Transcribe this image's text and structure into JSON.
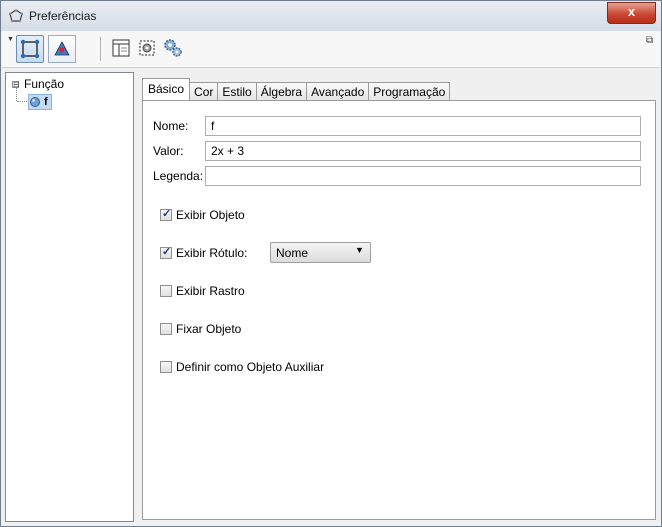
{
  "window": {
    "title": "Preferências",
    "close_label": "x"
  },
  "toolbar": {
    "buttons": [
      {
        "icon": "selection-rectangle-icon",
        "selected": true
      },
      {
        "icon": "graphics-view-icon",
        "selected": false
      },
      {
        "icon": "layout-icon",
        "selected": false
      },
      {
        "icon": "defaults-icon",
        "selected": false
      },
      {
        "icon": "advanced-gears-icon",
        "selected": false
      }
    ]
  },
  "tree": {
    "root_label": "Função",
    "expander": "⊟",
    "leaf_label": "f"
  },
  "tabs": [
    "Básico",
    "Cor",
    "Estilo",
    "Álgebra",
    "Avançado",
    "Programação"
  ],
  "form": {
    "name_label": "Nome:",
    "name_value": "f",
    "value_label": "Valor:",
    "value_value": "2x + 3",
    "caption_label": "Legenda:",
    "caption_value": ""
  },
  "checks": {
    "show_object": {
      "label": "Exibir Objeto",
      "checked": true
    },
    "show_label": {
      "label": "Exibir Rótulo:",
      "checked": true,
      "dropdown_value": "Nome"
    },
    "show_trace": {
      "label": "Exibir Rastro",
      "checked": false
    },
    "fix_object": {
      "label": "Fixar Objeto",
      "checked": false
    },
    "auxiliary": {
      "label": "Definir como Objeto Auxiliar",
      "checked": false
    }
  },
  "colors": {
    "accent": "#6b8fb3",
    "close": "#c7432f",
    "selection": "#c5daf0"
  }
}
